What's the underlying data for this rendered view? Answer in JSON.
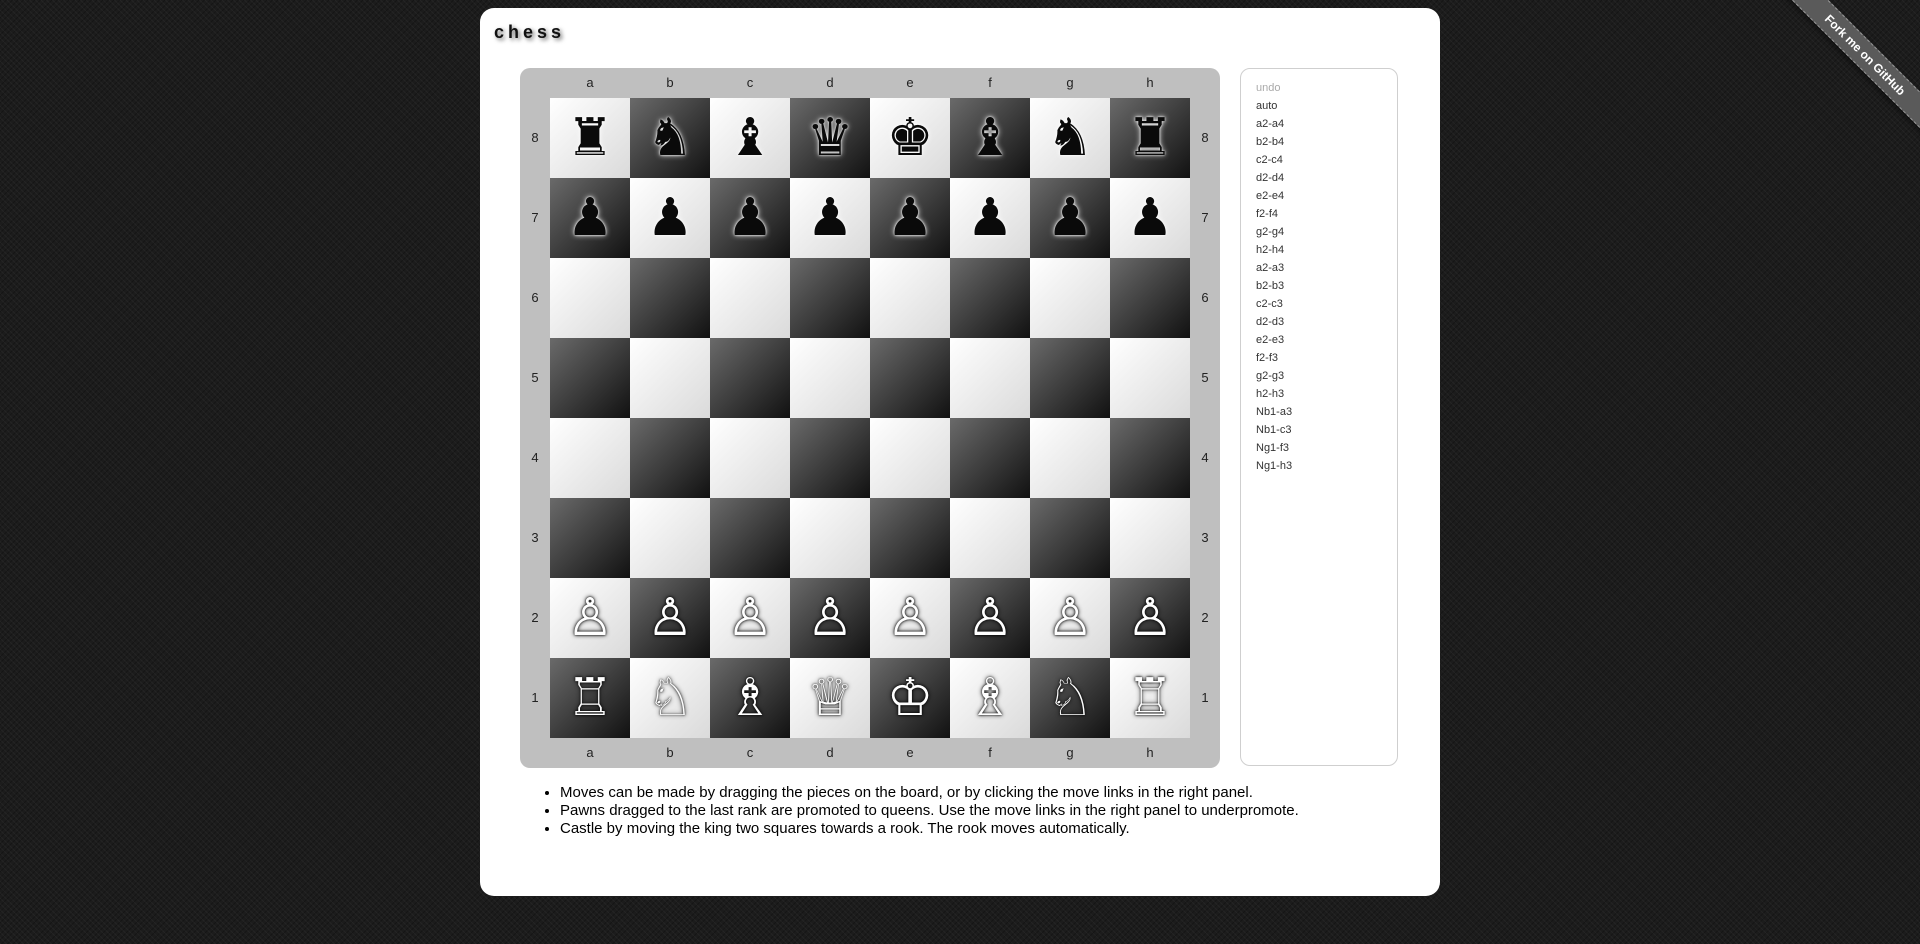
{
  "app": {
    "title": "chess"
  },
  "ribbon": {
    "label": "Fork me on GitHub"
  },
  "board": {
    "files": [
      "a",
      "b",
      "c",
      "d",
      "e",
      "f",
      "g",
      "h"
    ],
    "ranks": [
      "8",
      "7",
      "6",
      "5",
      "4",
      "3",
      "2",
      "1"
    ],
    "position": [
      [
        "r",
        "n",
        "b",
        "q",
        "k",
        "b",
        "n",
        "r"
      ],
      [
        "p",
        "p",
        "p",
        "p",
        "p",
        "p",
        "p",
        "p"
      ],
      [
        "",
        "",
        "",
        "",
        "",
        "",
        "",
        ""
      ],
      [
        "",
        "",
        "",
        "",
        "",
        "",
        "",
        ""
      ],
      [
        "",
        "",
        "",
        "",
        "",
        "",
        "",
        ""
      ],
      [
        "",
        "",
        "",
        "",
        "",
        "",
        "",
        ""
      ],
      [
        "P",
        "P",
        "P",
        "P",
        "P",
        "P",
        "P",
        "P"
      ],
      [
        "R",
        "N",
        "B",
        "Q",
        "K",
        "B",
        "N",
        "R"
      ]
    ],
    "colors": {
      "light": "#ffffff",
      "dark": "#111111",
      "frame": "#bfbfbf"
    }
  },
  "panel": {
    "undo_label": "undo",
    "auto_label": "auto",
    "moves": [
      "a2-a4",
      "b2-b4",
      "c2-c4",
      "d2-d4",
      "e2-e4",
      "f2-f4",
      "g2-g4",
      "h2-h4",
      "a2-a3",
      "b2-b3",
      "c2-c3",
      "d2-d3",
      "e2-e3",
      "f2-f3",
      "g2-g3",
      "h2-h3",
      "Nb1-a3",
      "Nb1-c3",
      "Ng1-f3",
      "Ng1-h3"
    ]
  },
  "notes": [
    "Moves can be made by dragging the pieces on the board, or by clicking the move links in the right panel.",
    "Pawns dragged to the last rank are promoted to queens. Use the move links in the right panel to underpromote.",
    "Castle by moving the king two squares towards a rook. The rook moves automatically."
  ]
}
